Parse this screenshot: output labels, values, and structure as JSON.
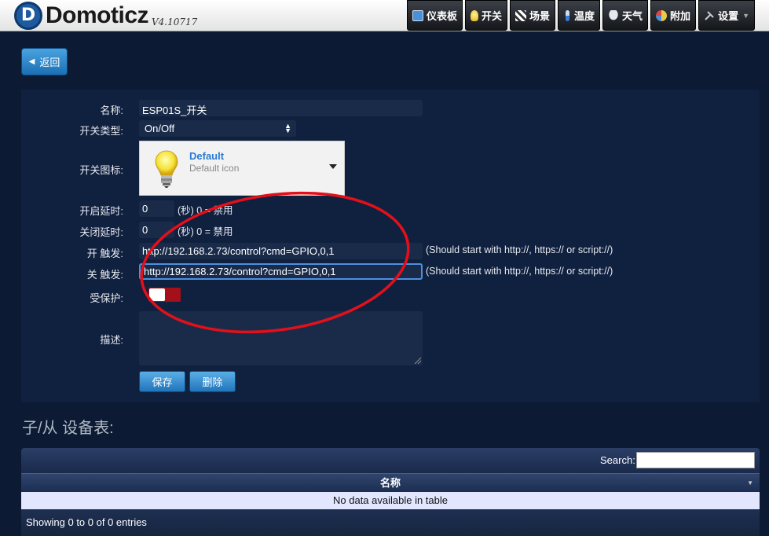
{
  "header": {
    "logo_letter": "D",
    "app_name": "Domoticz",
    "version": "V4.10717",
    "nav": [
      {
        "label": "仪表板",
        "icon": "dashboard-icon",
        "color": "#4a8fd9"
      },
      {
        "label": "开关",
        "icon": "lightbulb-icon",
        "color": "#f2d24a"
      },
      {
        "label": "场景",
        "icon": "clapperboard-icon",
        "color": "#cfd6e0"
      },
      {
        "label": "温度",
        "icon": "thermometer-icon",
        "color": "#5aa0e8"
      },
      {
        "label": "天气",
        "icon": "weather-icon",
        "color": "#b9c4d6"
      },
      {
        "label": "附加",
        "icon": "gauge-icon",
        "color": "#e8c84a"
      },
      {
        "label": "设置",
        "icon": "tools-icon",
        "color": "#c8ccd4"
      }
    ]
  },
  "back_button": {
    "label": "返回"
  },
  "form": {
    "name_label": "名称:",
    "name_value": "ESP01S_开关",
    "switch_type_label": "开关类型:",
    "switch_type_value": "On/Off",
    "switch_icon_label": "开关图标:",
    "icon_name": "Default",
    "icon_desc": "Default icon",
    "on_delay_label": "开启延时:",
    "on_delay_value": "0",
    "on_delay_hint": "(秒) 0 = 禁用",
    "off_delay_label": "关闭延时:",
    "off_delay_value": "0",
    "off_delay_hint": "(秒) 0 = 禁用",
    "on_action_label": "开 触发:",
    "on_action_value": "http://192.168.2.73/control?cmd=GPIO,0,1",
    "on_action_hint": "(Should start with http://, https:// or script://)",
    "off_action_label": "关 触发:",
    "off_action_value": "http://192.168.2.73/control?cmd=GPIO,0,1",
    "off_action_hint": "(Should start with http://, https:// or script://)",
    "protected_label": "受保护:",
    "description_label": "描述:",
    "save_label": "保存",
    "delete_label": "删除"
  },
  "sub_devices": {
    "title": "子/从 设备表:",
    "search_label": "Search:",
    "column_name": "名称",
    "empty_message": "No data available in table",
    "info": "Showing 0 to 0 of 0 entries"
  },
  "colors": {
    "background": "#0c1a33",
    "panel": "#10203f",
    "accent_blue": "#2074ba",
    "toggle_red": "#a3101a",
    "annotation_red": "#e3101a"
  }
}
